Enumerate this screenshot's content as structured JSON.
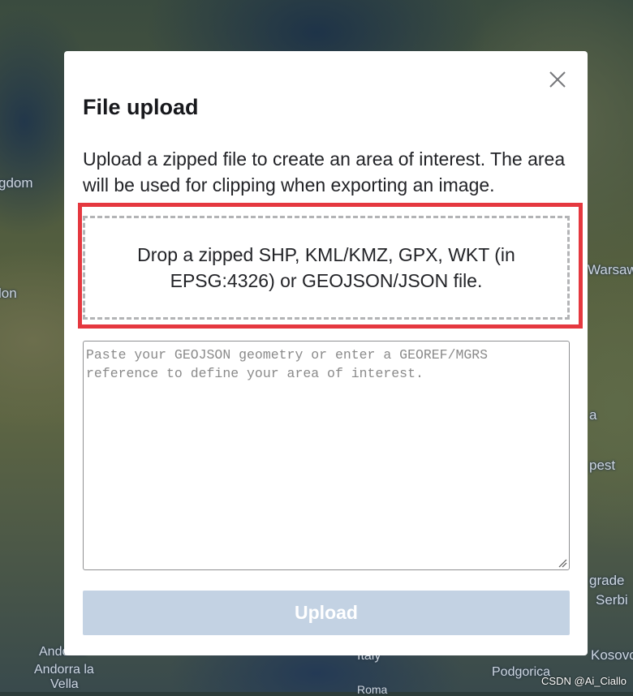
{
  "map": {
    "labels": [
      "gdom",
      "lon",
      "Warsaw",
      "a",
      "Kosovo",
      "pest",
      "grade",
      "Serbi",
      "Andorra",
      "Andorra la",
      "Vella",
      "Italy",
      "Podgorica",
      "Roma"
    ]
  },
  "watermark": "CSDN @Ai_Ciallo",
  "modal": {
    "title": "File upload",
    "close_icon": "close-icon",
    "description": "Upload a zipped file to create an area of interest. The area will be used for clipping when exporting an image.",
    "dropzone_text": "Drop a zipped SHP, KML/KMZ, GPX, WKT (in EPSG:4326) or GEOJSON/JSON file.",
    "highlight_color": "#e5383f",
    "textarea": {
      "value": "",
      "placeholder": "Paste your GEOJSON geometry or enter a GEOREF/MGRS reference to define your area of interest."
    },
    "upload_button": {
      "label": "Upload",
      "disabled": true,
      "color": "#c3d2e3"
    }
  }
}
